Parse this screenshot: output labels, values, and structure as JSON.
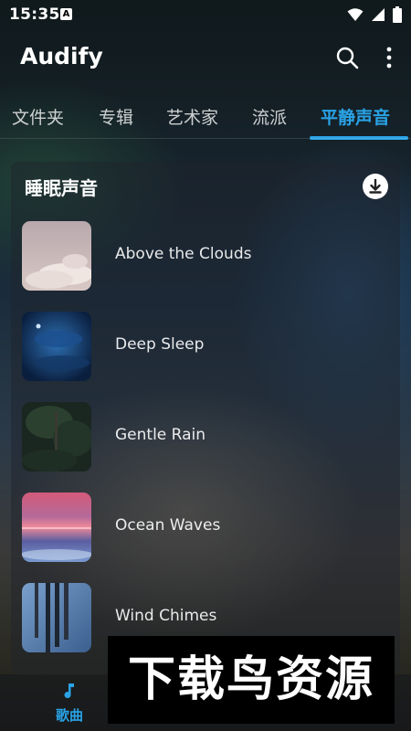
{
  "status_bar": {
    "time": "15:35",
    "badge": "A"
  },
  "app": {
    "title": "Audify"
  },
  "tabs": [
    {
      "label": "文件夹"
    },
    {
      "label": "专辑"
    },
    {
      "label": "艺术家"
    },
    {
      "label": "流派"
    },
    {
      "label": "平静声音",
      "active": true
    }
  ],
  "section": {
    "title": "睡眠声音",
    "tracks": [
      {
        "title": "Above the Clouds",
        "thumb": "clouds"
      },
      {
        "title": "Deep Sleep",
        "thumb": "night-sky"
      },
      {
        "title": "Gentle Rain",
        "thumb": "rain-forest"
      },
      {
        "title": "Ocean Waves",
        "thumb": "sunset-sea"
      },
      {
        "title": "Wind Chimes",
        "thumb": "chimes"
      }
    ]
  },
  "bottom_nav": {
    "songs_label": "歌曲"
  },
  "watermark": {
    "text": "下载鸟资源"
  },
  "colors": {
    "accent": "#29a3e6"
  }
}
